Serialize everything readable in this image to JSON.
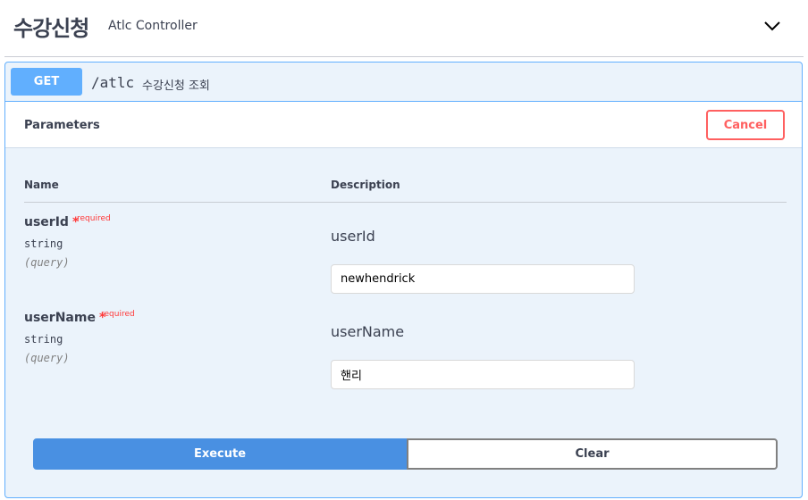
{
  "tag": {
    "title": "수강신청",
    "description": "Atlc Controller",
    "toggle_icon": "chevron-down-icon"
  },
  "operation": {
    "method": "GET",
    "path": "/atlc",
    "summary": "수강신청 조회",
    "method_color": "#61affe"
  },
  "parameters_section": {
    "title": "Parameters",
    "cancel_label": "Cancel",
    "columns": {
      "name": "Name",
      "description": "Description"
    }
  },
  "params": [
    {
      "name": "userId",
      "star": "*",
      "required_label": "required",
      "type": "string",
      "in": "(query)",
      "description": "userId",
      "value": "newhendrick"
    },
    {
      "name": "userName",
      "star": "*",
      "required_label": "required",
      "type": "string",
      "in": "(query)",
      "description": "userName",
      "value": "핸리"
    }
  ],
  "actions": {
    "execute_label": "Execute",
    "clear_label": "Clear",
    "execute_color": "#4990e2"
  }
}
